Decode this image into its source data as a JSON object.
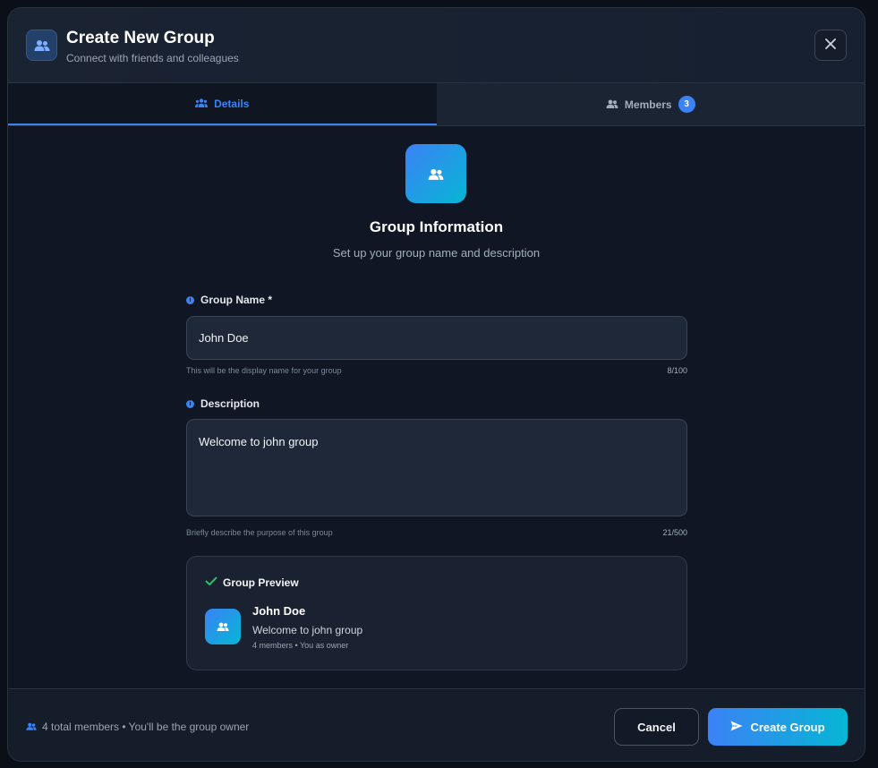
{
  "header": {
    "title": "Create New Group",
    "subtitle": "Connect with friends and colleagues",
    "icon": "users-icon",
    "close_icon": "close-icon"
  },
  "tabs": [
    {
      "label": "Details",
      "icon": "users-icon",
      "active": true
    },
    {
      "label": "Members",
      "icon": "users-icon",
      "active": false,
      "badge": "3"
    }
  ],
  "section": {
    "title": "Group Information",
    "subtitle": "Set up your group name and description"
  },
  "fields": {
    "group_name": {
      "label": "Group Name *",
      "value": "John Doe",
      "hint": "This will be the display name for your group",
      "counter": "8/100"
    },
    "description": {
      "label": "Description",
      "value": "Welcome to john group",
      "hint": "Briefly describe the purpose of this group",
      "counter": "21/500"
    }
  },
  "preview": {
    "title": "Group Preview",
    "name": "John Doe",
    "description": "Welcome to john group",
    "meta": "4 members • You as owner"
  },
  "footer": {
    "info": "4 total members • You'll be the group owner",
    "cancel_label": "Cancel",
    "create_label": "Create Group"
  },
  "colors": {
    "accent": "#3b82f6",
    "accent_2": "#06b6d4",
    "success": "#22c55e",
    "background": "#111827"
  }
}
